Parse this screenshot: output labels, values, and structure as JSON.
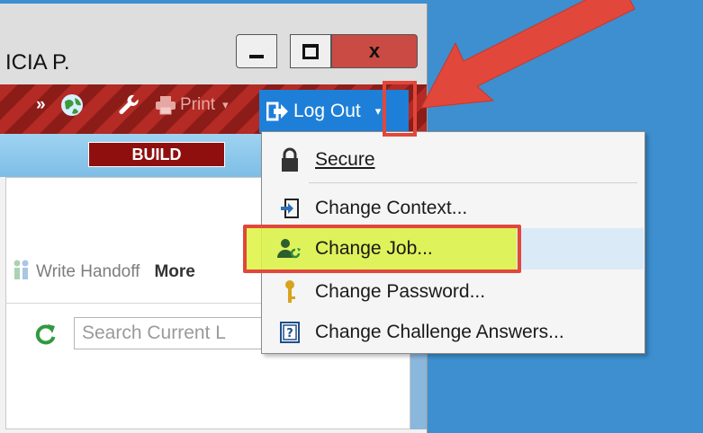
{
  "window": {
    "title": "ICIA P.",
    "close_label": "x"
  },
  "toolbar": {
    "chevrons": "»",
    "print_label": "Print",
    "print_caret": "▾",
    "logout_label": "Log Out",
    "logout_caret": "▾"
  },
  "build_badge": "BUILD",
  "content": {
    "handoff_label": "Write Handoff",
    "more_label": "More",
    "search_placeholder": "Search Current L"
  },
  "menu": {
    "items": [
      {
        "label": "Secure",
        "icon": "lock-icon"
      },
      {
        "label": "Change Context...",
        "icon": "enter-icon"
      },
      {
        "label": "Change Job...",
        "icon": "user-switch-icon"
      },
      {
        "label": "Change Password...",
        "icon": "key-icon"
      },
      {
        "label": "Change Challenge Answers...",
        "icon": "question-card-icon"
      }
    ]
  },
  "colors": {
    "desktop": "#3d8fcf",
    "toolbar_red": "#b42a24",
    "logout_blue": "#1e7fd8",
    "highlight_yellow": "#def33f",
    "annotation_red": "#e2473b"
  }
}
